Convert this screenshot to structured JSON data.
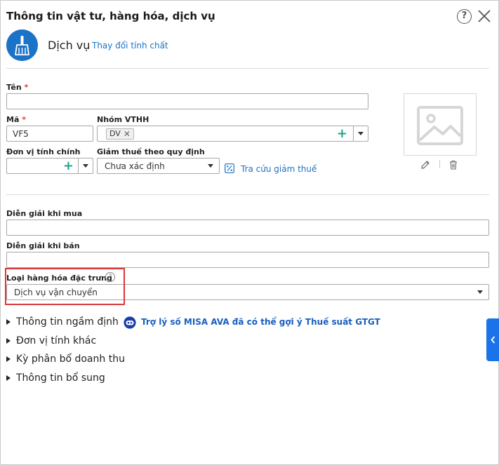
{
  "dialog": {
    "title": "Thông tin vật tư, hàng hóa, dịch vụ",
    "help_label": "?"
  },
  "item_type": {
    "label": "Dịch vụ",
    "change_link": "Thay đổi tính chất",
    "icon": "broom-icon"
  },
  "fields": {
    "name": {
      "label": "Tên",
      "required": "*",
      "value": ""
    },
    "code": {
      "label": "Mã",
      "required": "*",
      "value": "VF5"
    },
    "group": {
      "label": "Nhóm VTHH",
      "tag": "DV"
    },
    "unit": {
      "label": "Đơn vị tính chính",
      "value": ""
    },
    "tax_reduction": {
      "label": "Giảm thuế theo quy định",
      "value": "Chưa xác định"
    },
    "tax_lookup": {
      "label": "Tra cứu giảm thuế"
    },
    "purchase_desc": {
      "label": "Diễn giải khi mua",
      "value": ""
    },
    "sale_desc": {
      "label": "Diễn giải khi bán",
      "value": ""
    },
    "special_type": {
      "label": "Loại hàng hóa đặc trưng",
      "value": "Dịch vụ vận chuyển"
    }
  },
  "sections": {
    "default_info": "Thông tin ngầm định",
    "misa_ava": "Trợ lý số MISA AVA đã có thể gợi ý Thuế suất GTGT",
    "other_units": "Đơn vị tính khác",
    "revenue_period": "Kỳ phân bổ doanh thu",
    "additional_info": "Thông tin bổ sung"
  },
  "colors": {
    "accent": "#1a73c6",
    "plus": "#1ba58a",
    "highlight": "#d9373a",
    "required": "#e53935"
  }
}
